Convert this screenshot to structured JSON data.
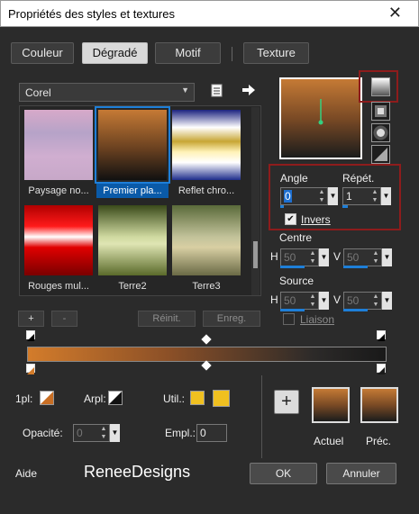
{
  "window": {
    "title": "Propriétés des styles et textures",
    "close_glyph": "✕"
  },
  "tabs": {
    "couleur": "Couleur",
    "degrade": "Dégradé",
    "motif": "Motif",
    "texture": "Texture"
  },
  "library": {
    "selected": "Corel"
  },
  "gallery": [
    {
      "label": "Paysage no...",
      "gradient": "linear-gradient(to bottom,#d7a9c9,#b6a3c8,#d0aed0,#c7a8c8)"
    },
    {
      "label": "Premier pla...",
      "gradient": "linear-gradient(to bottom,#c57a35,#6a4120 55%,#111 100%)",
      "selected": true
    },
    {
      "label": "Reflet chro...",
      "gradient": "linear-gradient(to bottom,#1c2380,#ffffff 25%,#c7a634 45%,#fff2b8 60%,#ffffff 75%,#1e2d8c)"
    },
    {
      "label": "Rouges mul...",
      "gradient": "linear-gradient(to bottom,#b00000,#ff1a1a 30%,#ffffff 45%,#e00000 60%,#7a0000)"
    },
    {
      "label": "Terre2",
      "gradient": "linear-gradient(to bottom,#3a4a1a,#cfd9a0 45%,#dfe5b3 55%,#5a6a2a)"
    },
    {
      "label": "Terre3",
      "gradient": "linear-gradient(to bottom,#5a6a3a,#c2c29a 45%,#d8cfa3 60%,#6a6a45)"
    }
  ],
  "buttons": {
    "add": "+",
    "remove": "-",
    "reset": "Réinit.",
    "save": "Enreg.",
    "ok": "OK",
    "cancel": "Annuler",
    "help": "Aide",
    "add_swatch": "+"
  },
  "angle": {
    "label": "Angle",
    "value": "0"
  },
  "repeat": {
    "label": "Répét.",
    "value": "1"
  },
  "invert": {
    "label": "Invers",
    "checked": true
  },
  "centre": {
    "label": "Centre",
    "h_label": "H",
    "h_value": "50",
    "v_label": "V",
    "v_value": "50"
  },
  "source": {
    "label": "Source",
    "h_label": "H",
    "h_value": "50",
    "v_label": "V",
    "v_value": "50"
  },
  "link": {
    "label": "Liaison",
    "checked": false
  },
  "stops": {
    "first_plane_label": "1pl:",
    "back_plane_label": "Arpl:",
    "user_label": "Util.:",
    "opacity_label": "Opacité:",
    "opacity_value": "0",
    "location_label": "Empl.:",
    "location_value": "0"
  },
  "colors": {
    "stop_left": "#d37c2b",
    "stop_right": "#191919",
    "user_color": "#f0c020",
    "highlight_border": "#8e1c1c"
  },
  "swatches": {
    "current_label": "Actuel",
    "previous_label": "Préc."
  },
  "brand": "ReneeDesigns"
}
